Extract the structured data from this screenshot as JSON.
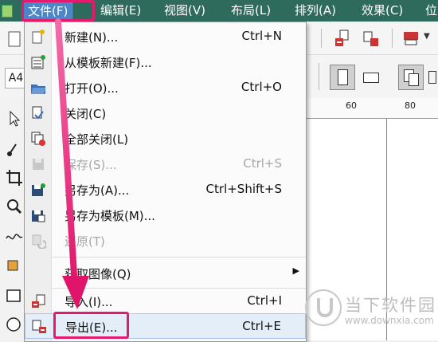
{
  "menubar": {
    "items": [
      {
        "label": "文件(F)",
        "active": true
      },
      {
        "label": "编辑(E)"
      },
      {
        "label": "视图(V)"
      },
      {
        "label": "布局(L)"
      },
      {
        "label": "排列(A)"
      },
      {
        "label": "效果(C)"
      },
      {
        "label": "位"
      }
    ]
  },
  "property_bar": {
    "page_size": "A4"
  },
  "ruler": {
    "labels": [
      "60",
      "80"
    ]
  },
  "file_menu": {
    "items": [
      {
        "label": "新建(N)...",
        "shortcut": "Ctrl+N",
        "icon": "new-document-icon",
        "enabled": true
      },
      {
        "label": "从模板新建(F)...",
        "shortcut": "",
        "icon": "new-from-template-icon",
        "enabled": true
      },
      {
        "label": "打开(O)...",
        "shortcut": "Ctrl+O",
        "icon": "open-folder-icon",
        "enabled": true
      },
      {
        "label": "关闭(C)",
        "shortcut": "",
        "icon": "close-document-icon",
        "enabled": true
      },
      {
        "label": "全部关闭(L)",
        "shortcut": "",
        "icon": "close-all-icon",
        "enabled": true
      },
      {
        "label": "保存(S)...",
        "shortcut": "Ctrl+S",
        "icon": "save-icon",
        "enabled": false
      },
      {
        "label": "另存为(A)...",
        "shortcut": "Ctrl+Shift+S",
        "icon": "save-as-icon",
        "enabled": true
      },
      {
        "label": "另存为模板(M)...",
        "shortcut": "",
        "icon": "save-as-template-icon",
        "enabled": true
      },
      {
        "label": "还原(T)",
        "shortcut": "",
        "icon": "revert-icon",
        "enabled": false
      },
      {
        "label": "获取图像(Q)",
        "shortcut": "",
        "icon": "",
        "enabled": true,
        "submenu": true
      },
      {
        "label": "导入(I)...",
        "shortcut": "Ctrl+I",
        "icon": "import-icon",
        "enabled": true
      },
      {
        "label": "导出(E)...",
        "shortcut": "Ctrl+E",
        "icon": "export-icon",
        "enabled": true,
        "highlighted": true
      }
    ]
  },
  "watermark": {
    "title": "当下软件园",
    "url": "www.downxia.com"
  },
  "colors": {
    "menubar_bg": "#2f6b5d",
    "annotation": "#e5196d",
    "highlight_bg": "#e4eef9"
  }
}
